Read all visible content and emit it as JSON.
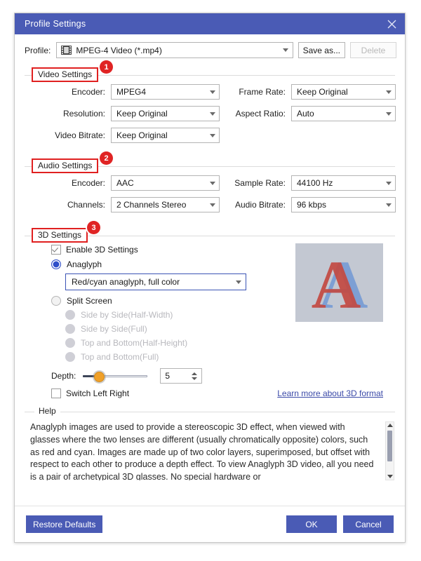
{
  "window": {
    "title": "Profile Settings",
    "close_icon": "close-icon"
  },
  "profile": {
    "label": "Profile:",
    "icon": "film-strip-icon",
    "value": "MPEG-4 Video (*.mp4)",
    "save_as_label": "Save as...",
    "delete_label": "Delete"
  },
  "video_settings": {
    "title": "Video Settings",
    "badge": "1",
    "encoder_label": "Encoder:",
    "encoder_value": "MPEG4",
    "frame_rate_label": "Frame Rate:",
    "frame_rate_value": "Keep Original",
    "resolution_label": "Resolution:",
    "resolution_value": "Keep Original",
    "aspect_ratio_label": "Aspect Ratio:",
    "aspect_ratio_value": "Auto",
    "video_bitrate_label": "Video Bitrate:",
    "video_bitrate_value": "Keep Original"
  },
  "audio_settings": {
    "title": "Audio Settings",
    "badge": "2",
    "encoder_label": "Encoder:",
    "encoder_value": "AAC",
    "sample_rate_label": "Sample Rate:",
    "sample_rate_value": "44100 Hz",
    "channels_label": "Channels:",
    "channels_value": "2 Channels Stereo",
    "audio_bitrate_label": "Audio Bitrate:",
    "audio_bitrate_value": "96 kbps"
  },
  "threed_settings": {
    "title": "3D Settings",
    "badge": "3",
    "enable_label": "Enable 3D Settings",
    "anaglyph_label": "Anaglyph",
    "anaglyph_mode_value": "Red/cyan anaglyph, full color",
    "split_screen_label": "Split Screen",
    "split_options": [
      "Side by Side(Half-Width)",
      "Side by Side(Full)",
      "Top and Bottom(Half-Height)",
      "Top and Bottom(Full)"
    ],
    "depth_label": "Depth:",
    "depth_value": "5",
    "switch_left_right_label": "Switch Left Right",
    "learn_more_label": "Learn more about 3D format",
    "preview_letter": "A",
    "preview_colors": {
      "red": "#c34a42",
      "blue": "#7d9fd4",
      "background": "#c3c8d2"
    }
  },
  "help": {
    "title": "Help",
    "text": "Anaglyph images are used to provide a stereoscopic 3D effect, when viewed with glasses where the two lenses are different (usually chromatically opposite) colors, such as red and cyan. Images are made up of two color layers, superimposed, but offset with respect to each other to produce a depth effect. To view Anaglyph 3D video, all you need is a pair of archetypical 3D glasses. No special hardware or"
  },
  "footer": {
    "restore_defaults_label": "Restore Defaults",
    "ok_label": "OK",
    "cancel_label": "Cancel"
  },
  "colors": {
    "accent": "#4a5bb5",
    "badge": "#e02424",
    "highlight_box": "#e02020",
    "link": "#3b4aa8"
  }
}
